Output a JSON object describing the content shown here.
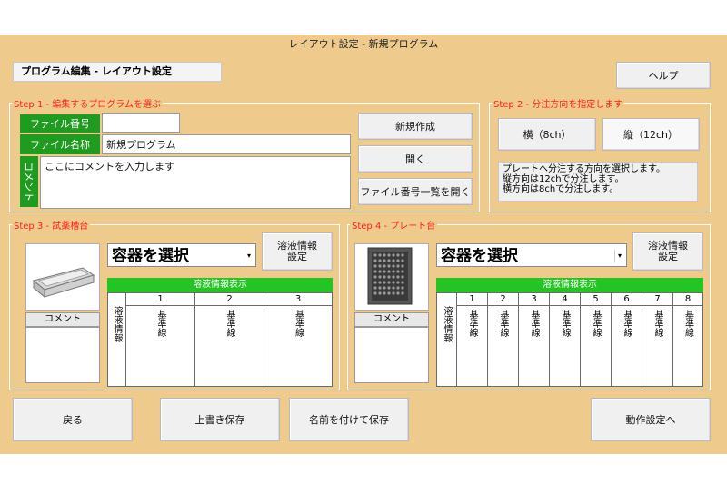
{
  "window": {
    "title": "レイアウト設定 - 新規プログラム"
  },
  "header": {
    "title": "プログラム編集 - レイアウト設定",
    "help_label": "ヘルプ"
  },
  "step1": {
    "legend": "Step 1 - 編集するプログラムを選ぶ",
    "file_number_label": "ファイル番号",
    "file_number_value": "",
    "file_name_label": "ファイル名称",
    "file_name_value": "新規プログラム",
    "comment_label": "コメント",
    "comment_value": "ここにコメントを入力します",
    "new_label": "新規作成",
    "open_label": "開く",
    "list_label": "ファイル番号一覧を開く"
  },
  "step2": {
    "legend": "Step 2 - 分注方向を指定します",
    "horizontal_label": "横（8ch）",
    "vertical_label": "縦（12ch）",
    "info_lines": [
      "プレートへ分注する方向を選択します。",
      "縦方向は12chで分注します。",
      "横方向は8chで分注します。"
    ]
  },
  "step3": {
    "legend": "Step 3 - 試薬槽台",
    "select_value": "容器を選択",
    "solution_btn": "溶液情報\n設定",
    "comment_label": "コメント",
    "table_title": "溶液情報表示",
    "row_label": "溶液情報",
    "columns": [
      {
        "num": "1",
        "value": "基準線"
      },
      {
        "num": "2",
        "value": "基準線"
      },
      {
        "num": "3",
        "value": "基準線"
      }
    ]
  },
  "step4": {
    "legend": "Step 4 - プレート台",
    "select_value": "容器を選択",
    "solution_btn": "溶液情報\n設定",
    "comment_label": "コメント",
    "table_title": "溶液情報表示",
    "row_label": "溶液情報",
    "columns": [
      {
        "num": "1",
        "value": "基準線"
      },
      {
        "num": "2",
        "value": "基準線"
      },
      {
        "num": "3",
        "value": "基準線"
      },
      {
        "num": "4",
        "value": "基準線"
      },
      {
        "num": "5",
        "value": "基準線"
      },
      {
        "num": "6",
        "value": "基準線"
      },
      {
        "num": "7",
        "value": "基準線"
      },
      {
        "num": "8",
        "value": "基準線"
      }
    ]
  },
  "footer": {
    "back_label": "戻る",
    "overwrite_label": "上書き保存",
    "save_as_label": "名前を付けて保存",
    "next_label": "動作設定へ"
  },
  "icons": {
    "reservoir": "reservoir-tray-icon",
    "plate": "well-plate-icon",
    "dropdown": "chevron-down-icon"
  }
}
